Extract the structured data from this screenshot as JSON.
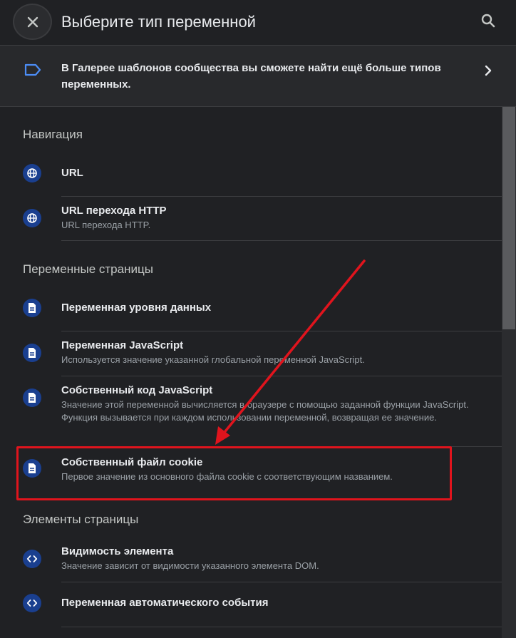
{
  "header": {
    "title": "Выберите тип переменной",
    "close_icon": "close-icon",
    "search_icon": "search-icon"
  },
  "banner": {
    "text": "В Галерее шаблонов сообщества вы сможете найти ещё больше типов переменных.",
    "icon": "tag-icon",
    "chevron": "chevron-right-icon"
  },
  "sections": [
    {
      "title": "Навигация",
      "items": [
        {
          "name": "URL",
          "icon": "globe-icon"
        },
        {
          "name": "URL перехода HTTP",
          "description": "URL перехода HTTP.",
          "icon": "globe-icon"
        }
      ]
    },
    {
      "title": "Переменные страницы",
      "items": [
        {
          "name": "Переменная уровня данных",
          "icon": "document-icon"
        },
        {
          "name": "Переменная JavaScript",
          "description": "Используется значение указанной глобальной переменной JavaScript.",
          "icon": "document-icon"
        },
        {
          "name": "Собственный код JavaScript",
          "description": "Значение этой переменной вычисляется в браузере с помощью заданной функции JavaScript. Функция вызывается при каждом использовании переменной, возвращая ее значение.",
          "icon": "document-icon"
        },
        {
          "name": "Собственный файл cookie",
          "description": "Первое значение из основного файла cookie с соответствующим названием.",
          "icon": "document-icon"
        }
      ]
    },
    {
      "title": "Элементы страницы",
      "items": [
        {
          "name": "Видимость элемента",
          "description": "Значение зависит от видимости указанного элемента DOM.",
          "icon": "code-icon"
        },
        {
          "name": "Переменная автоматического события",
          "icon": "code-icon"
        }
      ]
    }
  ],
  "colors": {
    "background": "#202124",
    "icon_circle": "#1a3f8f",
    "annotation_red": "#e0141d"
  }
}
